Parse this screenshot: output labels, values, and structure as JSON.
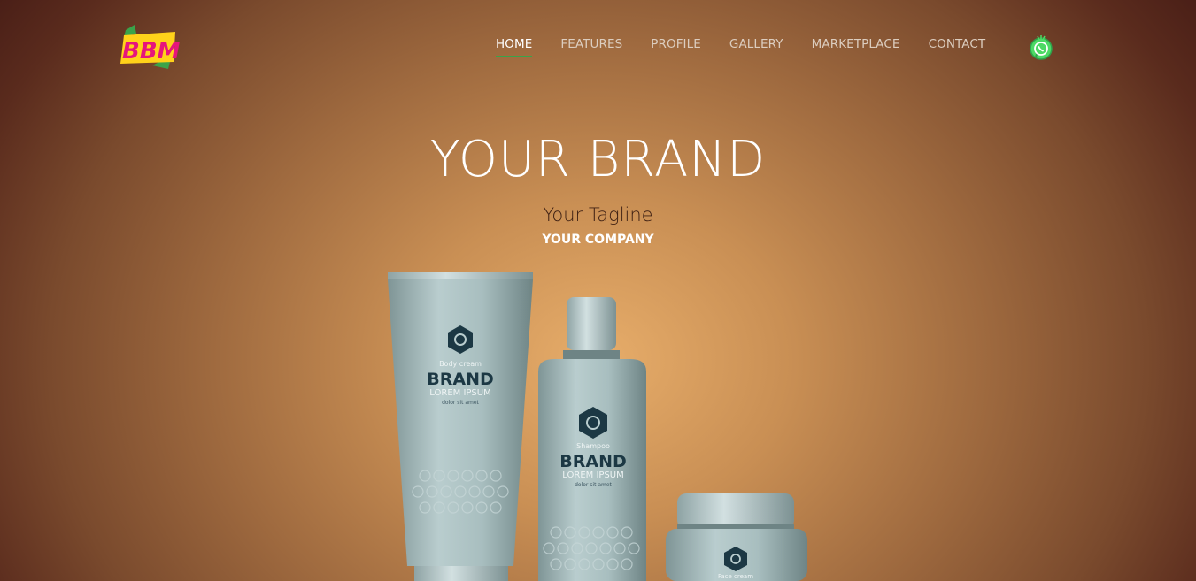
{
  "brand": {
    "logo_text": "BBM"
  },
  "nav": {
    "items": [
      {
        "label": "HOME",
        "active": true
      },
      {
        "label": "FEATURES",
        "active": false
      },
      {
        "label": "PROFILE",
        "active": false
      },
      {
        "label": "GALLERY",
        "active": false
      },
      {
        "label": "MARKETPLACE",
        "active": false
      },
      {
        "label": "CONTACT",
        "active": false
      }
    ],
    "social_icon": "whatsapp-icon"
  },
  "hero": {
    "title": "YOUR BRAND",
    "tagline": "Your Tagline",
    "company": "YOUR COMPANY"
  },
  "products": {
    "tube": {
      "type": "Body cream",
      "brand": "BRAND",
      "lorem": "LOREM IPSUM",
      "sub": "dolor sit amet"
    },
    "bottle": {
      "type": "Shampoo",
      "brand": "BRAND",
      "lorem": "LOREM IPSUM",
      "sub": "dolor sit amet"
    },
    "jar": {
      "type": "Face cream"
    }
  },
  "colors": {
    "accent": "#3aa34a",
    "background_center": "#e7ad6a",
    "background_edge": "#4a1f17",
    "product": "#9fb4b5",
    "label_dark": "#1c3844"
  }
}
